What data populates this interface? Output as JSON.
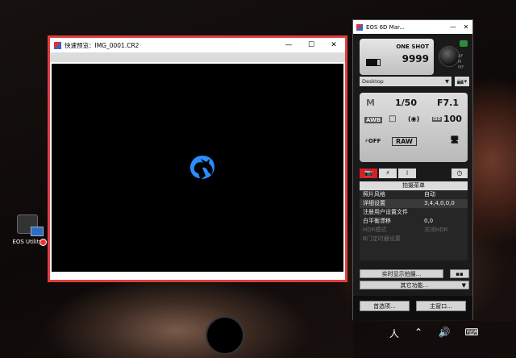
{
  "desktop": {
    "icon_label": "EOS Utility",
    "icon": "camera-app-icon"
  },
  "preview_window": {
    "title": "快速预览：IMG_0001.CR2",
    "controls": {
      "minimize": "—",
      "maximize": "☐",
      "close": "✕"
    },
    "highlight_color": "#e0403e",
    "logo_color": "#2a8cff"
  },
  "eos_panel": {
    "title": "EOS 6D Mar...",
    "controls": {
      "minimize": "—",
      "close": "✕"
    },
    "lcd": {
      "drive": "ONE SHOT",
      "shots_remaining": "9999",
      "battery": "battery-icon"
    },
    "mode_indicator": "AF\nM\nMF",
    "destination": {
      "value": "Desktop",
      "arrow": "▼",
      "camera_dd": "📷▾"
    },
    "settings": {
      "mode": "M",
      "shutter": "1/50",
      "aperture": "F7.1",
      "wb": "AWB",
      "drive": "□",
      "metering": "(◉)",
      "iso_label": "ISO",
      "iso": "100",
      "flash": "⚡OFF",
      "quality": "RAW",
      "transfer": "🖥"
    },
    "tabs": [
      "📷",
      "⚡",
      "𝍷"
    ],
    "timer_tab": "◷",
    "menu": {
      "header": "拍摄菜单",
      "rows": [
        {
          "label": "照片风格",
          "value": "自动",
          "dim": false
        },
        {
          "label": "  详细设置",
          "value": "3,4,4,0,0,0",
          "dim": false
        },
        {
          "label": "  注册用户设置文件",
          "value": "",
          "dim": false
        },
        {
          "label": "白平衡漂移",
          "value": "0,0",
          "dim": false
        },
        {
          "label": "HDR模式",
          "value": "关闭HDR",
          "dim": true
        },
        {
          "label": "B门定时器设置",
          "value": "",
          "dim": true
        }
      ]
    },
    "live_view_button": "实时显示拍摄...",
    "live_icon": "▪▪",
    "other_functions": "其它功能...",
    "other_arrow": "▼",
    "preferences_button": "首选项...",
    "main_window_button": "主窗口..."
  },
  "taskbar": {
    "tray": [
      "人",
      "⌃",
      "🔊",
      "⌨"
    ]
  }
}
